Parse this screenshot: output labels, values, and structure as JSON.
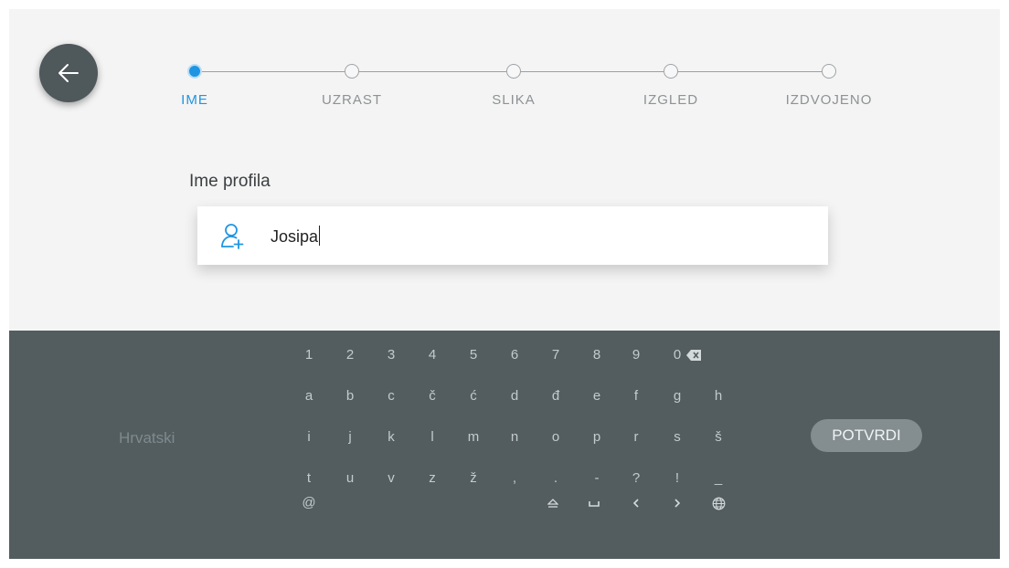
{
  "stepper": {
    "steps": [
      {
        "label": "IME",
        "active": true
      },
      {
        "label": "UZRAST",
        "active": false
      },
      {
        "label": "SLIKA",
        "active": false
      },
      {
        "label": "IZGLED",
        "active": false
      },
      {
        "label": "IZDVOJENO",
        "active": false
      }
    ]
  },
  "form": {
    "label": "Ime profila",
    "value": "Josipa",
    "icon": "user-add-icon"
  },
  "keyboard": {
    "language": "Hrvatski",
    "confirm_label": "POTVRDI",
    "rows": [
      [
        "1",
        "2",
        "3",
        "4",
        "5",
        "6",
        "7",
        "8",
        "9",
        "0"
      ],
      [
        "a",
        "b",
        "c",
        "č",
        "ć",
        "d",
        "đ",
        "e",
        "f",
        "g",
        "h"
      ],
      [
        "i",
        "j",
        "k",
        "l",
        "m",
        "n",
        "o",
        "p",
        "r",
        "s",
        "š"
      ],
      [
        "t",
        "u",
        "v",
        "z",
        "ž",
        ",",
        ".",
        "-",
        "?",
        "!",
        "_"
      ],
      [
        "@"
      ]
    ],
    "special_keys": [
      "backspace-icon",
      "shift-icon",
      "space-icon",
      "arrow-left-icon",
      "arrow-right-icon",
      "globe-icon"
    ]
  },
  "colors": {
    "accent": "#1e95e3",
    "keyboard_bg": "#535d60",
    "page_bg": "#f4f4f4",
    "button_bg": "#848d90"
  }
}
